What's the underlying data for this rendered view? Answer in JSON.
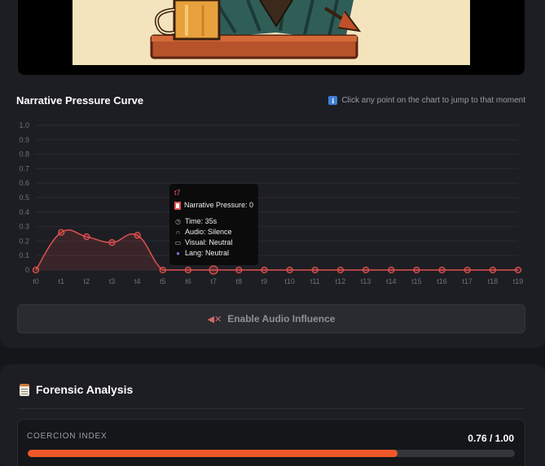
{
  "pressure_section": {
    "title": "Narrative Pressure Curve",
    "hint_icon": "info-icon",
    "hint": "Click any point on the chart to jump to that moment"
  },
  "chart_data": {
    "type": "line",
    "x": [
      "t0",
      "t1",
      "t2",
      "t3",
      "t4",
      "t5",
      "t6",
      "t7",
      "t8",
      "t9",
      "t10",
      "t11",
      "t12",
      "t13",
      "t14",
      "t15",
      "t16",
      "t17",
      "t18",
      "t19"
    ],
    "series": [
      {
        "values": [
          0,
          0.26,
          0.23,
          0.19,
          0.24,
          0,
          0,
          0,
          0,
          0,
          0,
          0,
          0,
          0,
          0,
          0,
          0,
          0,
          0,
          0
        ],
        "color": "#e05050"
      }
    ],
    "yticks": [
      "0",
      "0.1",
      "0.2",
      "0.3",
      "0.4",
      "0.5",
      "0.6",
      "0.7",
      "0.8",
      "0.9",
      "1.0"
    ],
    "ylim": [
      0,
      1
    ],
    "grid": true,
    "active_point": "t7"
  },
  "tooltip": {
    "title": "t7",
    "pressure": "Narrative Pressure: 0",
    "time": "Time: 35s",
    "audio": "Audio: Silence",
    "visual": "Visual: Neutral",
    "lang": "Lang: Neutral"
  },
  "audio_button": {
    "label": "Enable Audio Influence",
    "icon": "speaker-muted-icon"
  },
  "forensic": {
    "title": "Forensic Analysis",
    "icon": "clipboard-icon",
    "metric_label": "COERCION INDEX",
    "metric_value": "0.76 / 1.00",
    "metric_fraction": 0.76,
    "accent": "#f0582a"
  }
}
